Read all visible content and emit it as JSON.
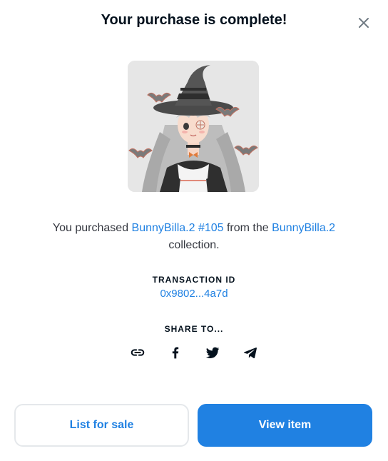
{
  "modal": {
    "title": "Your purchase is complete!",
    "close_icon": "close-icon"
  },
  "artwork": {
    "alt": "BunnyBilla.2 #105",
    "background_color": "#e8e8e8"
  },
  "message": {
    "prefix": "You purchased",
    "item_name": "BunnyBilla.2 #105",
    "middle": "from the",
    "collection_name": "BunnyBilla.2",
    "suffix": "collection."
  },
  "transaction": {
    "label": "TRANSACTION ID",
    "id": "0x9802...4a7d"
  },
  "share": {
    "label": "SHARE TO...",
    "icons": [
      "link-icon",
      "facebook-icon",
      "twitter-icon",
      "telegram-icon"
    ]
  },
  "actions": {
    "list_for_sale": "List for sale",
    "view_item": "View item"
  },
  "colors": {
    "accent": "#2081e2",
    "text": "#04111d",
    "muted_text": "#353840",
    "border": "#e5e8eb"
  }
}
